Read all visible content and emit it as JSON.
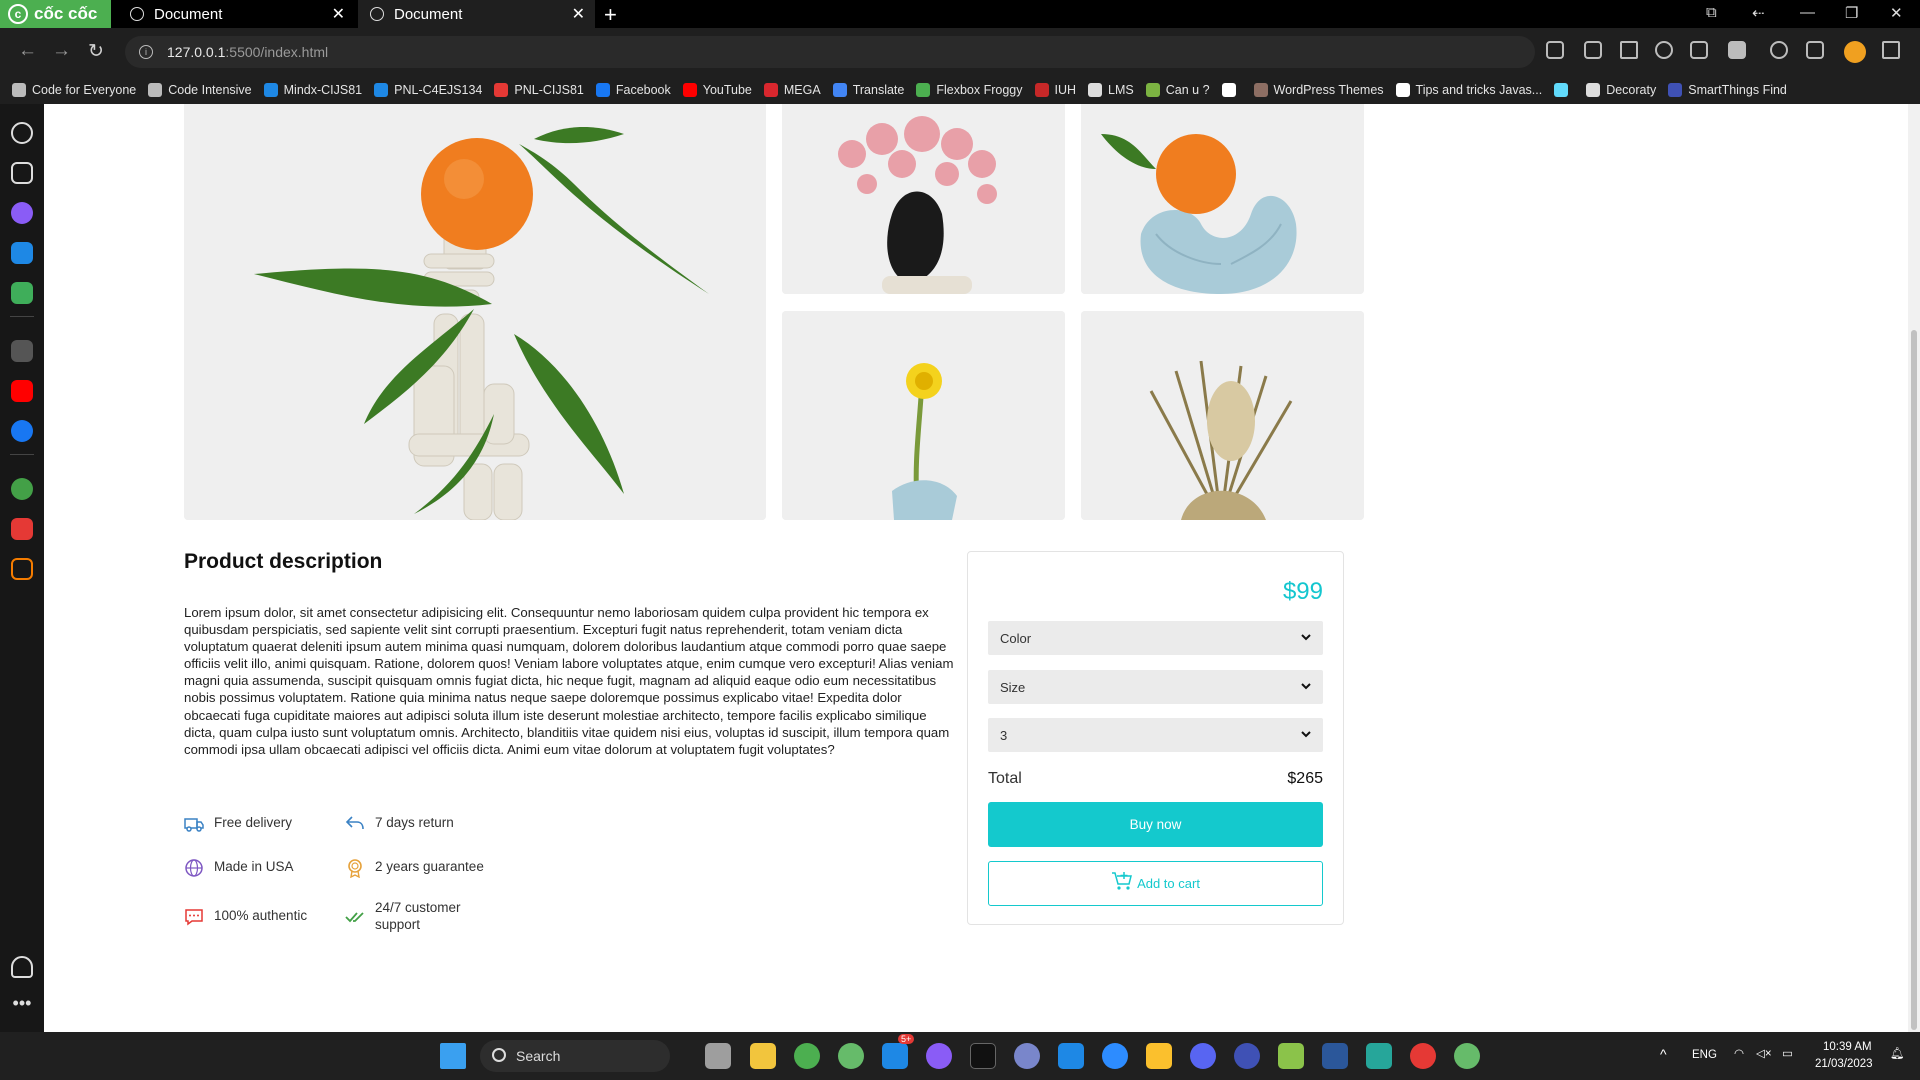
{
  "browser": {
    "brand": "cốc cốc",
    "tabs": [
      {
        "title": "Document"
      },
      {
        "title": "Document"
      }
    ],
    "url_host": "127.0.0.1",
    "url_path": ":5500/index.html",
    "bookmarks": [
      {
        "label": "Code for Everyone",
        "color": "#bbbbbb"
      },
      {
        "label": "Code Intensive",
        "color": "#bbbbbb"
      },
      {
        "label": "Mindx-CIJS81",
        "color": "#1e88e5"
      },
      {
        "label": "PNL-C4EJS134",
        "color": "#1e88e5"
      },
      {
        "label": "PNL-CIJS81",
        "color": "#e53935"
      },
      {
        "label": "Facebook",
        "color": "#1877f2"
      },
      {
        "label": "YouTube",
        "color": "#ff0000"
      },
      {
        "label": "MEGA",
        "color": "#d9272e"
      },
      {
        "label": "Translate",
        "color": "#4285f4"
      },
      {
        "label": "Flexbox Froggy",
        "color": "#4caf50"
      },
      {
        "label": "IUH",
        "color": "#c62828"
      },
      {
        "label": "LMS",
        "color": "#dddddd"
      },
      {
        "label": "Can u ?",
        "color": "#7cb342"
      },
      {
        "label": "",
        "color": "#ffffff"
      },
      {
        "label": "WordPress Themes",
        "color": "#8d6e63"
      },
      {
        "label": "Tips and tricks Javas...",
        "color": "#ffffff"
      },
      {
        "label": "",
        "color": "#61dafb"
      },
      {
        "label": "Decoraty",
        "color": "#dddddd"
      },
      {
        "label": "SmartThings Find",
        "color": "#3f51b5"
      }
    ]
  },
  "product": {
    "description_title": "Product description",
    "description_body": "Lorem ipsum dolor, sit amet consectetur adipisicing elit. Consequuntur nemo laboriosam quidem culpa provident hic tempora ex quibusdam perspiciatis, sed sapiente velit sint corrupti praesentium. Excepturi fugit natus reprehenderit, totam veniam dicta voluptatum quaerat deleniti ipsum autem minima quasi numquam, dolorem doloribus laudantium atque commodi porro quae saepe officiis velit illo, animi quisquam. Ratione, dolorem quos! Veniam labore voluptates atque, enim cumque vero excepturi! Alias veniam magni quia assumenda, suscipit quisquam omnis fugiat dicta, hic neque fugit, magnam ad aliquid eaque odio eum necessitatibus nobis possimus voluptatem. Ratione quia minima natus neque saepe doloremque possimus explicabo vitae! Expedita dolor obcaecati fuga cupiditate maiores aut adipisci soluta illum iste deserunt molestiae architecto, tempore facilis explicabo similique dicta, quam culpa iusto sunt voluptatum omnis. Architecto, blanditiis vitae quidem nisi eius, voluptas id suscipit, illum tempora quam commodi ipsa ullam obcaecati adipisci vel officiis dicta. Animi eum vitae dolorum at voluptatem fugit voluptates?",
    "features": [
      {
        "icon": "truck-icon",
        "label": "Free delivery",
        "color": "#3b82c4"
      },
      {
        "icon": "return-arrow-icon",
        "label": "7 days return",
        "color": "#3b82c4"
      },
      {
        "icon": "globe-icon",
        "label": "Made in USA",
        "color": "#7e57c2"
      },
      {
        "icon": "award-icon",
        "label": "2 years guarantee",
        "color": "#e6a23c"
      },
      {
        "icon": "message-icon",
        "label": "100% authentic",
        "color": "#e53935"
      },
      {
        "icon": "double-check-icon",
        "label": "24/7 customer support",
        "color": "#43a047"
      }
    ],
    "price": "$99",
    "color_select": "Color",
    "size_select": "Size",
    "quantity_select": "3",
    "total_label": "Total",
    "total_value": "$265",
    "buy_label": "Buy now",
    "cart_label": "Add to cart",
    "accent_color": "#14c9cd"
  },
  "taskbar": {
    "search_label": "Search",
    "language": "ENG",
    "time": "10:39 AM",
    "date": "21/03/2023",
    "badge": "5+"
  }
}
